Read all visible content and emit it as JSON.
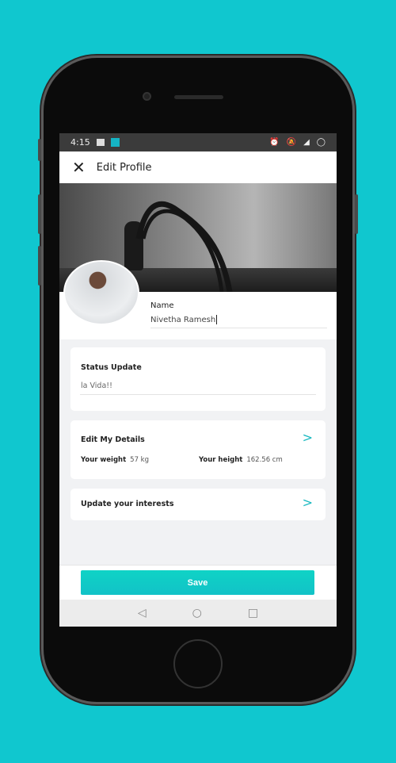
{
  "status_bar": {
    "time": "4:15",
    "icons": [
      "image-icon",
      "app-icon",
      "alarm-icon",
      "notifications-off-icon",
      "signal-icon",
      "battery-icon"
    ]
  },
  "app_bar": {
    "title": "Edit Profile",
    "close_icon": "close-icon"
  },
  "profile": {
    "name_label": "Name",
    "name_value": "Nivetha Ramesh"
  },
  "status_card": {
    "title": "Status Update",
    "value": "la Vida!!"
  },
  "details_card": {
    "title": "Edit My Details",
    "weight_label": "Your weight",
    "weight_value": "57 kg",
    "height_label": "Your height",
    "height_value": "162.56 cm"
  },
  "interests_card": {
    "title": "Update your interests"
  },
  "save_label": "Save",
  "colors": {
    "background": "#10c7cf",
    "accent": "#12c2c7"
  }
}
